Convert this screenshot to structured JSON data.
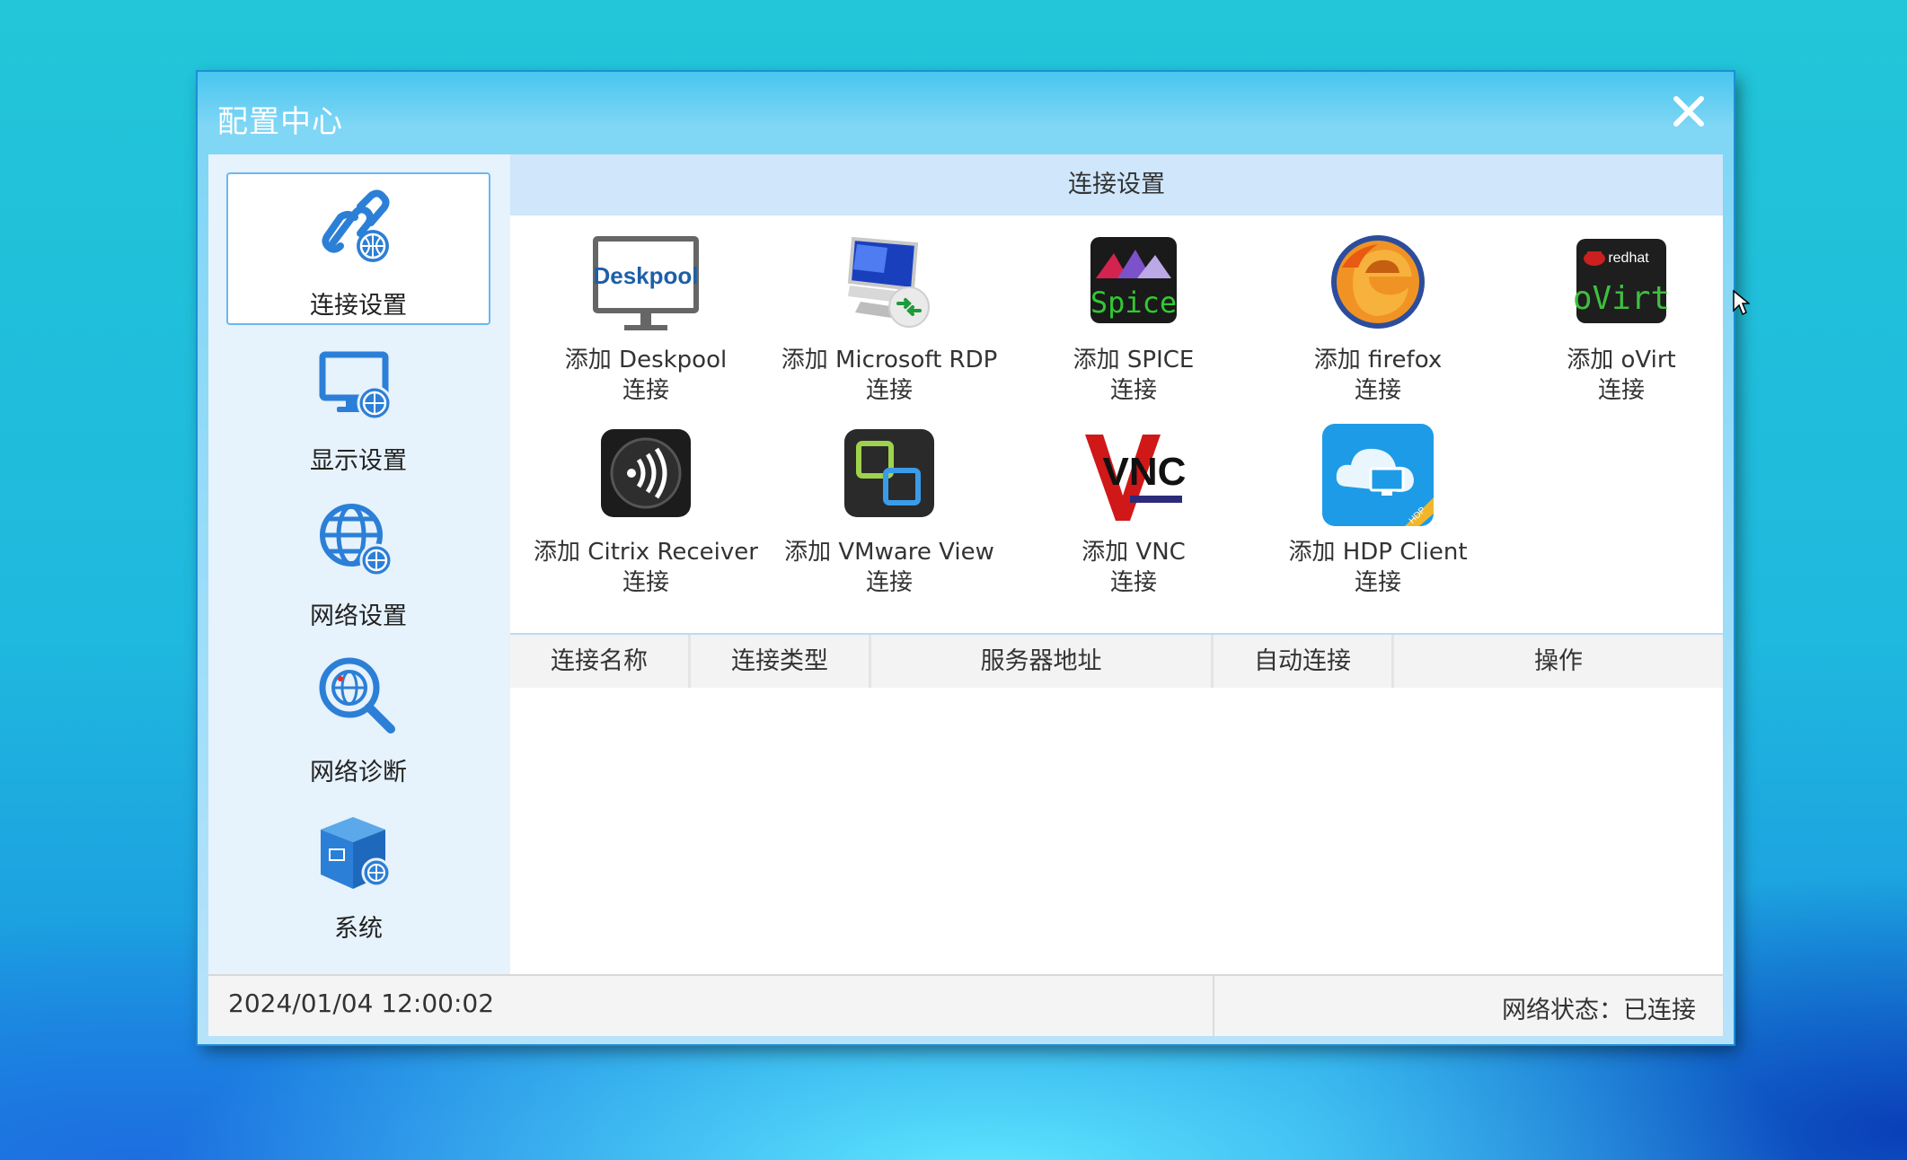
{
  "window": {
    "title": "配置中心"
  },
  "sidebar": {
    "items": [
      {
        "label": "连接设置",
        "icon": "link-globe-icon",
        "active": true
      },
      {
        "label": "显示设置",
        "icon": "monitor-globe-icon"
      },
      {
        "label": "网络设置",
        "icon": "network-globe-icon"
      },
      {
        "label": "网络诊断",
        "icon": "diagnose-magnifier-icon"
      },
      {
        "label": "系统",
        "icon": "system-box-icon"
      }
    ]
  },
  "content": {
    "header": "连接设置",
    "tiles": [
      {
        "line1": "添加 Deskpool",
        "line2": "连接",
        "icon": "deskpool-icon",
        "icon_text": "Deskpool"
      },
      {
        "line1": "添加 Microsoft RDP",
        "line2": "连接",
        "icon": "microsoft-rdp-icon"
      },
      {
        "line1": "添加 SPICE",
        "line2": "连接",
        "icon": "spice-icon",
        "icon_text": "Spice"
      },
      {
        "line1": "添加 firefox",
        "line2": "连接",
        "icon": "firefox-icon"
      },
      {
        "line1": "添加 oVirt",
        "line2": "连接",
        "icon": "ovirt-icon",
        "icon_text": "oVirt",
        "icon_subtext": "redhat"
      },
      {
        "line1": "添加 Citrix Receiver",
        "line2": "连接",
        "icon": "citrix-receiver-icon"
      },
      {
        "line1": "添加 VMware View",
        "line2": "连接",
        "icon": "vmware-view-icon"
      },
      {
        "line1": "添加 VNC",
        "line2": "连接",
        "icon": "vnc-icon",
        "icon_text": "VNC"
      },
      {
        "line1": "添加 HDP Client",
        "line2": "连接",
        "icon": "hdp-client-icon",
        "icon_text": "HDP"
      }
    ],
    "table": {
      "columns": [
        "连接名称",
        "连接类型",
        "服务器地址",
        "自动连接",
        "操作"
      ],
      "rows": []
    }
  },
  "statusbar": {
    "datetime": "2024/01/04 12:00:02",
    "network_status": "网络状态：已连接"
  }
}
